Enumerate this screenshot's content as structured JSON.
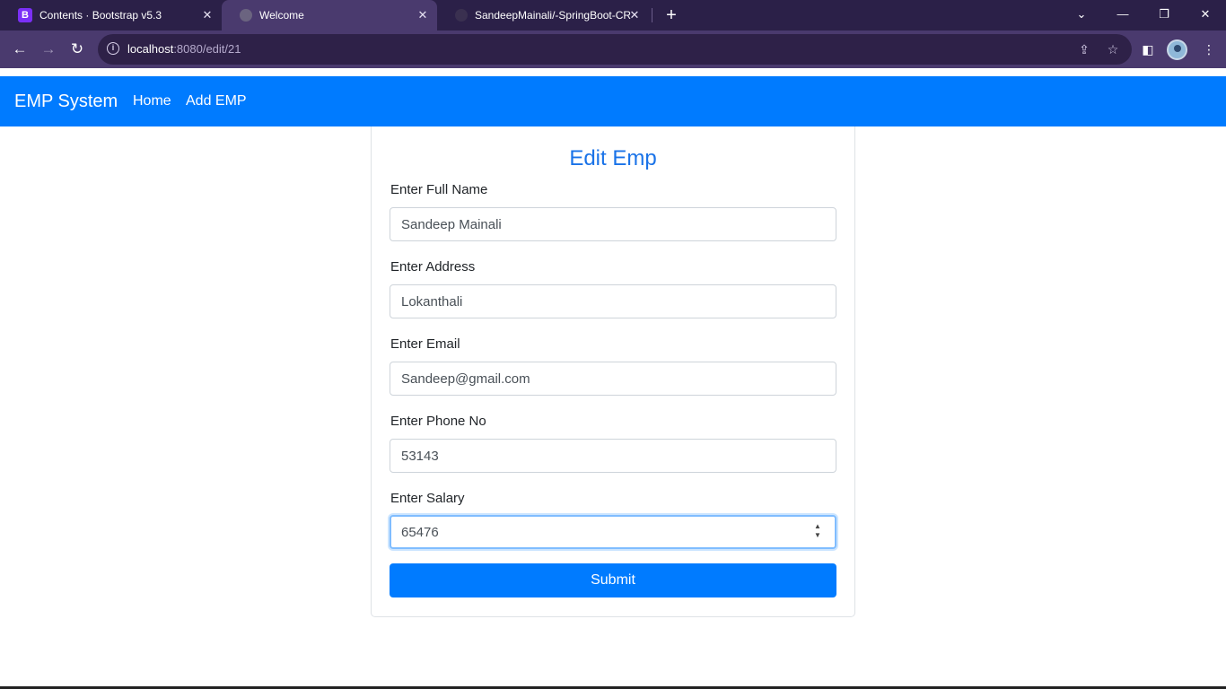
{
  "browser": {
    "tabs": [
      {
        "title": "Contents · Bootstrap v5.3",
        "favicon": "B",
        "active": false
      },
      {
        "title": "Welcome",
        "favicon": "",
        "active": true
      },
      {
        "title": "SandeepMainali/-SpringBoot-CR",
        "favicon": "",
        "active": false
      }
    ],
    "url_host": "localhost",
    "url_rest": ":8080/edit/21"
  },
  "navbar": {
    "brand": "EMP System",
    "links": [
      "Home",
      "Add EMP"
    ],
    "bg_color": "#007bff"
  },
  "form": {
    "title": "Edit Emp",
    "fields": [
      {
        "label": "Enter Full Name",
        "value": "Sandeep Mainali"
      },
      {
        "label": "Enter Address",
        "value": "Lokanthali"
      },
      {
        "label": "Enter Email",
        "value": "Sandeep@gmail.com"
      },
      {
        "label": "Enter Phone No",
        "value": "53143"
      },
      {
        "label": "Enter Salary",
        "value": "65476"
      }
    ],
    "submit_label": "Submit"
  }
}
